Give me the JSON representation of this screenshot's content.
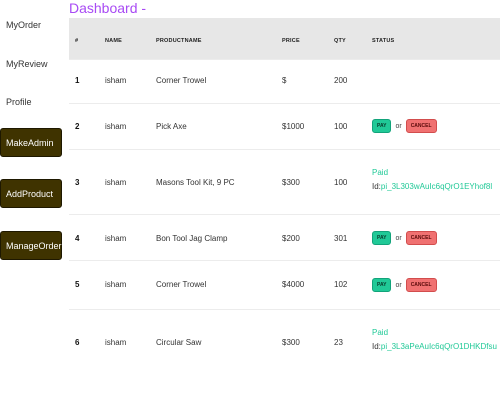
{
  "page_title": "Dashboard -",
  "sidebar": {
    "links": [
      {
        "label": "MyOrder"
      },
      {
        "label": "MyReview"
      },
      {
        "label": "Profile"
      }
    ],
    "buttons": [
      {
        "label": "MakeAdmin"
      },
      {
        "label": "AddProduct"
      },
      {
        "label": "ManageOrder"
      }
    ]
  },
  "table": {
    "headers": {
      "num": "#",
      "name": "NAME",
      "product": "PRODUCTNAME",
      "price": "PRICE",
      "qty": "QTY",
      "status": "STATUS"
    },
    "rows": [
      {
        "num": "1",
        "name": "isham",
        "product": "Corner Trowel",
        "price": "$",
        "qty": "200",
        "status": {
          "type": "none"
        }
      },
      {
        "num": "2",
        "name": "isham",
        "product": "Pick Axe",
        "price": "$1000",
        "qty": "100",
        "status": {
          "type": "actions",
          "pay": "PAY",
          "or": "or",
          "cancel": "CANCEL"
        }
      },
      {
        "num": "3",
        "name": "isham",
        "product": "Masons Tool Kit, 9 PC",
        "price": "$300",
        "qty": "100",
        "status": {
          "type": "paid",
          "paid": "Paid",
          "id_label": "Id:",
          "id": "pi_3L303wAuIc6qQrO1EYhof8l"
        }
      },
      {
        "num": "4",
        "name": "isham",
        "product": "Bon Tool Jag Clamp",
        "price": "$200",
        "qty": "301",
        "status": {
          "type": "actions",
          "pay": "PAY",
          "or": "or",
          "cancel": "CANCEL"
        }
      },
      {
        "num": "5",
        "name": "isham",
        "product": "Corner Trowel",
        "price": "$4000",
        "qty": "102",
        "status": {
          "type": "actions",
          "pay": "PAY",
          "or": "or",
          "cancel": "CANCEL"
        }
      },
      {
        "num": "6",
        "name": "isham",
        "product": "Circular Saw",
        "price": "$300",
        "qty": "23",
        "status": {
          "type": "paid",
          "paid": "Paid",
          "id_label": "Id:",
          "id": "pi_3L3aPeAuIc6qQrO1DHKDfsu"
        }
      }
    ]
  },
  "colors": {
    "title": "#a84af4",
    "sidebar_button": "#3f3300",
    "pay": "#20c997",
    "cancel": "#f07171",
    "paid": "#20c997",
    "header_bg": "#e7e7e7"
  }
}
